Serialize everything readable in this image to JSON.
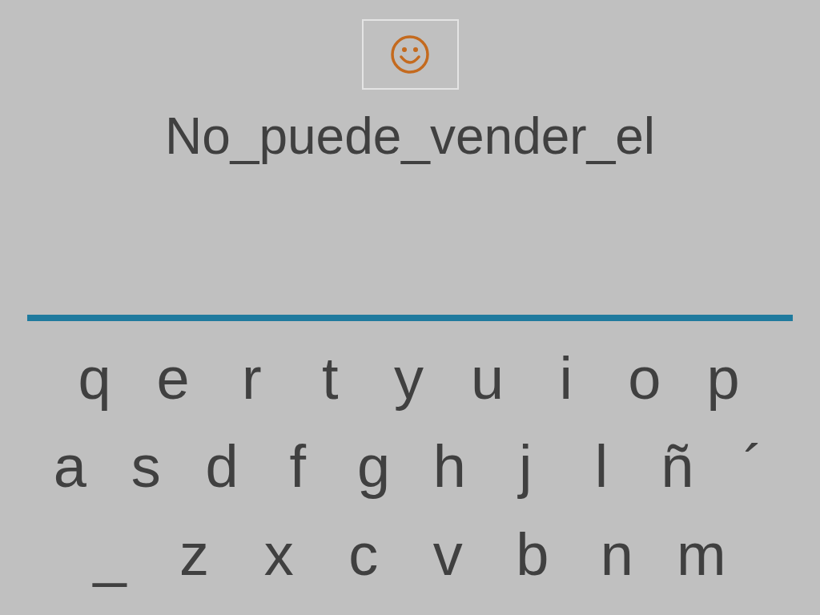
{
  "answer": "No_puede_vender_el",
  "keyboard": {
    "rows": [
      [
        "q",
        "e",
        "r",
        "t",
        "y",
        "u",
        "i",
        "o",
        "p"
      ],
      [
        "a",
        "s",
        "d",
        "f",
        "g",
        "h",
        "j",
        "l",
        "ñ",
        "´"
      ],
      [
        "_",
        "z",
        "x",
        "c",
        "v",
        "b",
        "n",
        "m"
      ]
    ]
  }
}
